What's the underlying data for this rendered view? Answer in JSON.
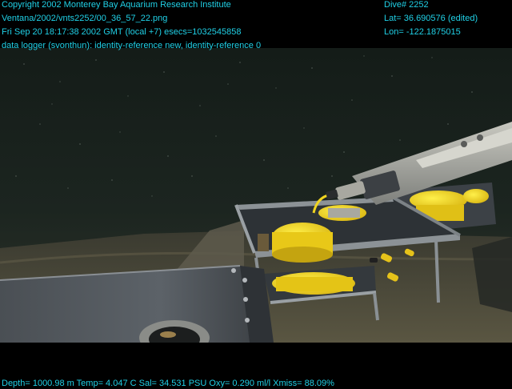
{
  "overlay": {
    "header_left": [
      "Copyright 2002 Monterey Bay Aquarium Research Institute",
      "Ventana/2002/vnts2252/00_36_57_22.png",
      "Fri Sep 20 18:17:38 2002 GMT (local +7)  esecs=1032545858",
      "data logger (svonthun): identity-reference new, identity-reference 0"
    ],
    "header_right": [
      "Dive# 2252",
      "Lat= 36.690576 (edited)",
      "Lon= -122.1875015"
    ],
    "footer": "Depth= 1000.98 m  Temp= 4.047 C  Sal= 34.531 PSU  Oxy= 0.290 ml/l  Xmiss= 88.09%"
  },
  "colors": {
    "overlay_text": "#20d0e6",
    "background": "#000000",
    "water": "#1f2a24",
    "seafloor": "#4a4a3a",
    "equipment_yellow": "#f2d21a",
    "frame_metal": "#6f7478"
  }
}
